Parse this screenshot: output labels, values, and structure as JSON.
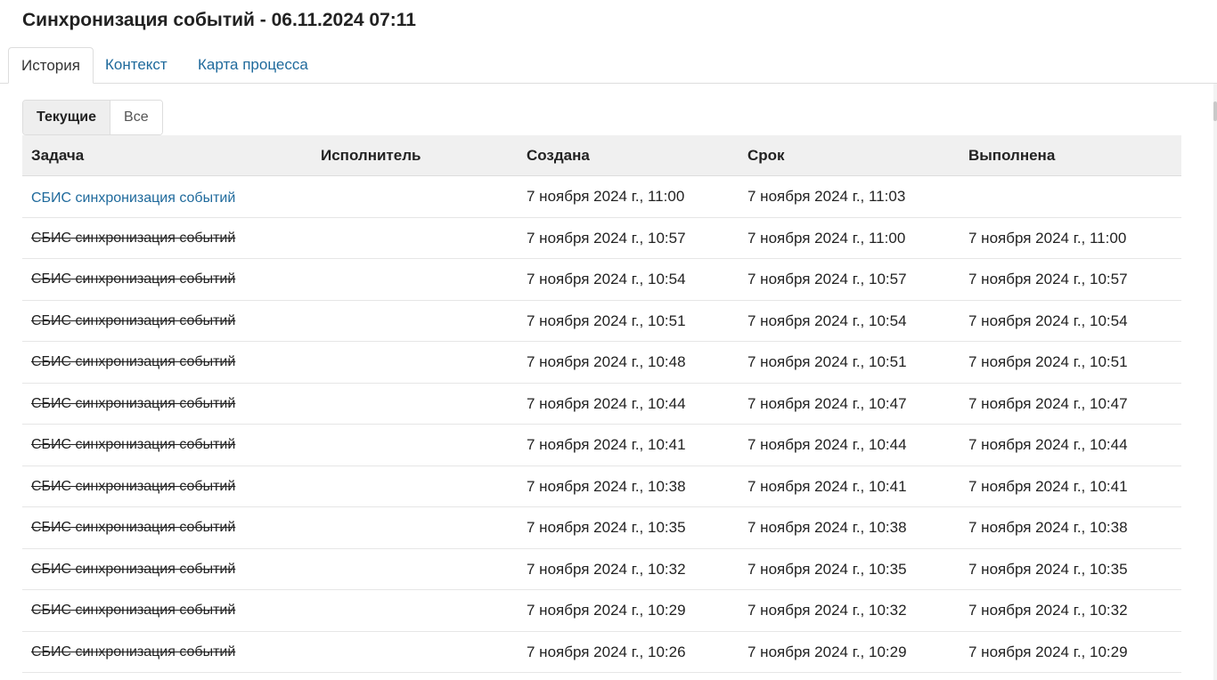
{
  "page": {
    "title": "Синхронизация событий - 06.11.2024 07:11"
  },
  "tabs": [
    {
      "label": "История",
      "active": true
    },
    {
      "label": "Контекст",
      "active": false
    },
    {
      "label": "Карта процесса",
      "active": false
    }
  ],
  "filter": {
    "current_label": "Текущие",
    "all_label": "Все",
    "selected": "Текущие"
  },
  "table": {
    "columns": [
      "Задача",
      "Исполнитель",
      "Создана",
      "Срок",
      "Выполнена"
    ],
    "rows": [
      {
        "task": "СБИС синхронизация событий",
        "assignee": "",
        "created": "7 ноября 2024 г., 11:00",
        "deadline": "7 ноября 2024 г., 11:03",
        "completed": ""
      },
      {
        "task": "СБИС синхронизация событий",
        "assignee": "",
        "created": "7 ноября 2024 г., 10:57",
        "deadline": "7 ноября 2024 г., 11:00",
        "completed": "7 ноября 2024 г., 11:00"
      },
      {
        "task": "СБИС синхронизация событий",
        "assignee": "",
        "created": "7 ноября 2024 г., 10:54",
        "deadline": "7 ноября 2024 г., 10:57",
        "completed": "7 ноября 2024 г., 10:57"
      },
      {
        "task": "СБИС синхронизация событий",
        "assignee": "",
        "created": "7 ноября 2024 г., 10:51",
        "deadline": "7 ноября 2024 г., 10:54",
        "completed": "7 ноября 2024 г., 10:54"
      },
      {
        "task": "СБИС синхронизация событий",
        "assignee": "",
        "created": "7 ноября 2024 г., 10:48",
        "deadline": "7 ноября 2024 г., 10:51",
        "completed": "7 ноября 2024 г., 10:51"
      },
      {
        "task": "СБИС синхронизация событий",
        "assignee": "",
        "created": "7 ноября 2024 г., 10:44",
        "deadline": "7 ноября 2024 г., 10:47",
        "completed": "7 ноября 2024 г., 10:47"
      },
      {
        "task": "СБИС синхронизация событий",
        "assignee": "",
        "created": "7 ноября 2024 г., 10:41",
        "deadline": "7 ноября 2024 г., 10:44",
        "completed": "7 ноября 2024 г., 10:44"
      },
      {
        "task": "СБИС синхронизация событий",
        "assignee": "",
        "created": "7 ноября 2024 г., 10:38",
        "deadline": "7 ноября 2024 г., 10:41",
        "completed": "7 ноября 2024 г., 10:41"
      },
      {
        "task": "СБИС синхронизация событий",
        "assignee": "",
        "created": "7 ноября 2024 г., 10:35",
        "deadline": "7 ноября 2024 г., 10:38",
        "completed": "7 ноября 2024 г., 10:38"
      },
      {
        "task": "СБИС синхронизация событий",
        "assignee": "",
        "created": "7 ноября 2024 г., 10:32",
        "deadline": "7 ноября 2024 г., 10:35",
        "completed": "7 ноября 2024 г., 10:35"
      },
      {
        "task": "СБИС синхронизация событий",
        "assignee": "",
        "created": "7 ноября 2024 г., 10:29",
        "deadline": "7 ноября 2024 г., 10:32",
        "completed": "7 ноября 2024 г., 10:32"
      },
      {
        "task": "СБИС синхронизация событий",
        "assignee": "",
        "created": "7 ноября 2024 г., 10:26",
        "deadline": "7 ноября 2024 г., 10:29",
        "completed": "7 ноября 2024 г., 10:29"
      }
    ]
  },
  "colors": {
    "link": "#1f6a9c",
    "header_bg": "#f0f0f0",
    "border": "#dddddd"
  }
}
